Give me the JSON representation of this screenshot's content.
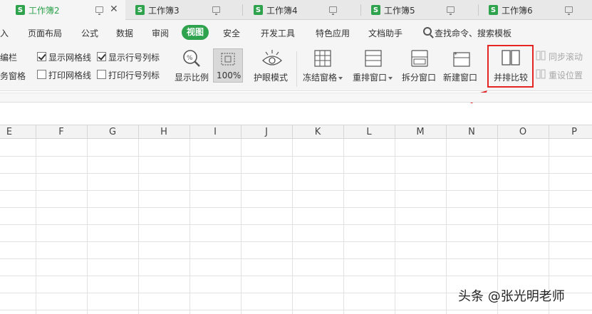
{
  "tabs": [
    {
      "label": "工作簿2",
      "active": true
    },
    {
      "label": "工作簿3",
      "active": false
    },
    {
      "label": "工作簿4",
      "active": false
    },
    {
      "label": "工作簿5",
      "active": false
    },
    {
      "label": "工作簿6",
      "active": false
    }
  ],
  "tab_logo": "S",
  "menu": {
    "items": [
      "入",
      "页面布局",
      "公式",
      "数据",
      "审阅",
      "视图",
      "安全",
      "开发工具",
      "特色应用",
      "文档助手"
    ],
    "active": "视图",
    "search_label": "查找命令、搜索模板"
  },
  "ribbon": {
    "left_top": "编栏",
    "left_bottom": "务窗格",
    "show_gridlines": {
      "label": "显示网格线",
      "checked": true
    },
    "show_row_col_headers": {
      "label": "显示行号列标",
      "checked": true
    },
    "print_gridlines": {
      "label": "打印网格线",
      "checked": false
    },
    "print_row_col_headers": {
      "label": "打印行号列标",
      "checked": false
    },
    "zoom_label": "显示比例",
    "zoom_value": "100%",
    "eye_mode": "护眼模式",
    "freeze_panes": "冻结窗格",
    "arrange_windows": "重排窗口",
    "split_window": "拆分窗口",
    "new_window": "新建窗口",
    "side_by_side": "并排比较",
    "sync_scroll": "同步滚动",
    "reset_position": "重设位置"
  },
  "columns": [
    "E",
    "F",
    "G",
    "H",
    "I",
    "J",
    "K",
    "L",
    "M",
    "N",
    "O",
    "P"
  ],
  "watermark": "头条 @张光明老师",
  "colors": {
    "accent_green": "#2ea24d",
    "highlight_red": "#e52424"
  }
}
